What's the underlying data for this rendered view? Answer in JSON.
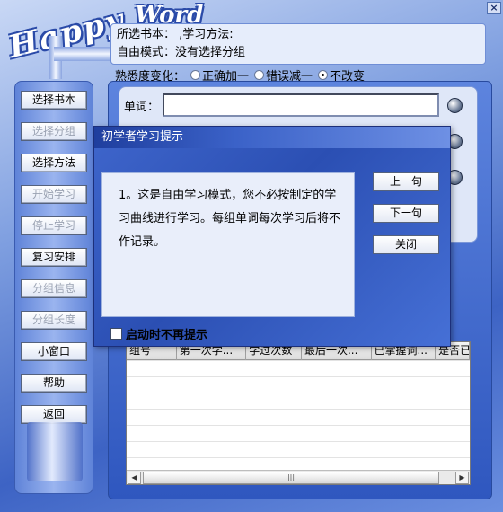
{
  "window": {
    "logo_left": "Happy",
    "logo_right": "Word",
    "close_glyph": "×"
  },
  "info": {
    "line1": "所选书本： ,学习方法:",
    "line2": "自由模式：没有选择分组"
  },
  "familiarity": {
    "label": "熟悉度变化：",
    "options": [
      "正确加一",
      "错误减一",
      "不改变"
    ],
    "selected": "不改变"
  },
  "sidebar": {
    "buttons": [
      {
        "label": "选择书本",
        "enabled": true
      },
      {
        "label": "选择分组",
        "enabled": false
      },
      {
        "label": "选择方法",
        "enabled": true
      },
      {
        "label": "开始学习",
        "enabled": false
      },
      {
        "label": "停止学习",
        "enabled": false
      },
      {
        "label": "复习安排",
        "enabled": true
      },
      {
        "label": "分组信息",
        "enabled": false
      },
      {
        "label": "分组长度",
        "enabled": false
      },
      {
        "label": "小窗口",
        "enabled": true
      },
      {
        "label": "帮助",
        "enabled": true
      },
      {
        "label": "返回",
        "enabled": true
      }
    ]
  },
  "word": {
    "label": "单词：",
    "value": ""
  },
  "table": {
    "columns": [
      "组号",
      "第一次学...",
      "学过次数",
      "最后一次...",
      "已掌握词...",
      "是否已"
    ]
  },
  "dialog": {
    "title": "初学者学习提示",
    "message": "1。这是自由学习模式，您不必按制定的学习曲线进行学习。每组单词每次学习后将不作记录。",
    "buttons": {
      "prev": "上一句",
      "next": "下一句",
      "close": "关闭"
    },
    "checkbox_label": "启动时不再提示",
    "checkbox_checked": false
  },
  "colors": {
    "accent": "#3b62c8",
    "panel": "#dfe7f8"
  }
}
